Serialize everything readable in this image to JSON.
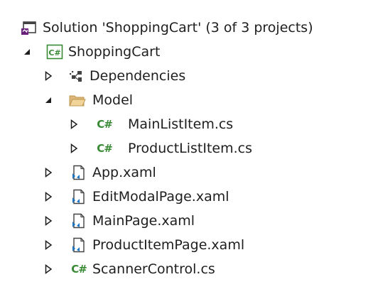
{
  "solution": {
    "label": "Solution 'ShoppingCart' (3 of 3 projects)"
  },
  "items": [
    {
      "label": "ShoppingCart",
      "depth": 1,
      "state": "expanded",
      "icon": "csharp-project-icon"
    },
    {
      "label": "Dependencies",
      "depth": 2,
      "state": "collapsed",
      "icon": "dependencies-icon"
    },
    {
      "label": "Model",
      "depth": 2,
      "state": "expanded",
      "icon": "folder-open-icon"
    },
    {
      "label": "MainListItem.cs",
      "depth": 3,
      "state": "collapsed",
      "icon": "csharp-file-icon"
    },
    {
      "label": "ProductListItem.cs",
      "depth": 3,
      "state": "collapsed",
      "icon": "csharp-file-icon"
    },
    {
      "label": "App.xaml",
      "depth": 2,
      "state": "collapsed",
      "icon": "xaml-file-icon"
    },
    {
      "label": "EditModalPage.xaml",
      "depth": 2,
      "state": "collapsed",
      "icon": "xaml-file-icon"
    },
    {
      "label": "MainPage.xaml",
      "depth": 2,
      "state": "collapsed",
      "icon": "xaml-file-icon"
    },
    {
      "label": "ProductItemPage.xaml",
      "depth": 2,
      "state": "collapsed",
      "icon": "xaml-file-icon"
    },
    {
      "label": "ScannerControl.cs",
      "depth": 2,
      "state": "collapsed",
      "icon": "csharp-file-icon"
    }
  ],
  "colors": {
    "text": "#1e1e1e",
    "csharp_green": "#388a34",
    "folder_fill": "#dcb67a",
    "vs_purple": "#68217a",
    "xaml_blue": "#1e75bd"
  }
}
